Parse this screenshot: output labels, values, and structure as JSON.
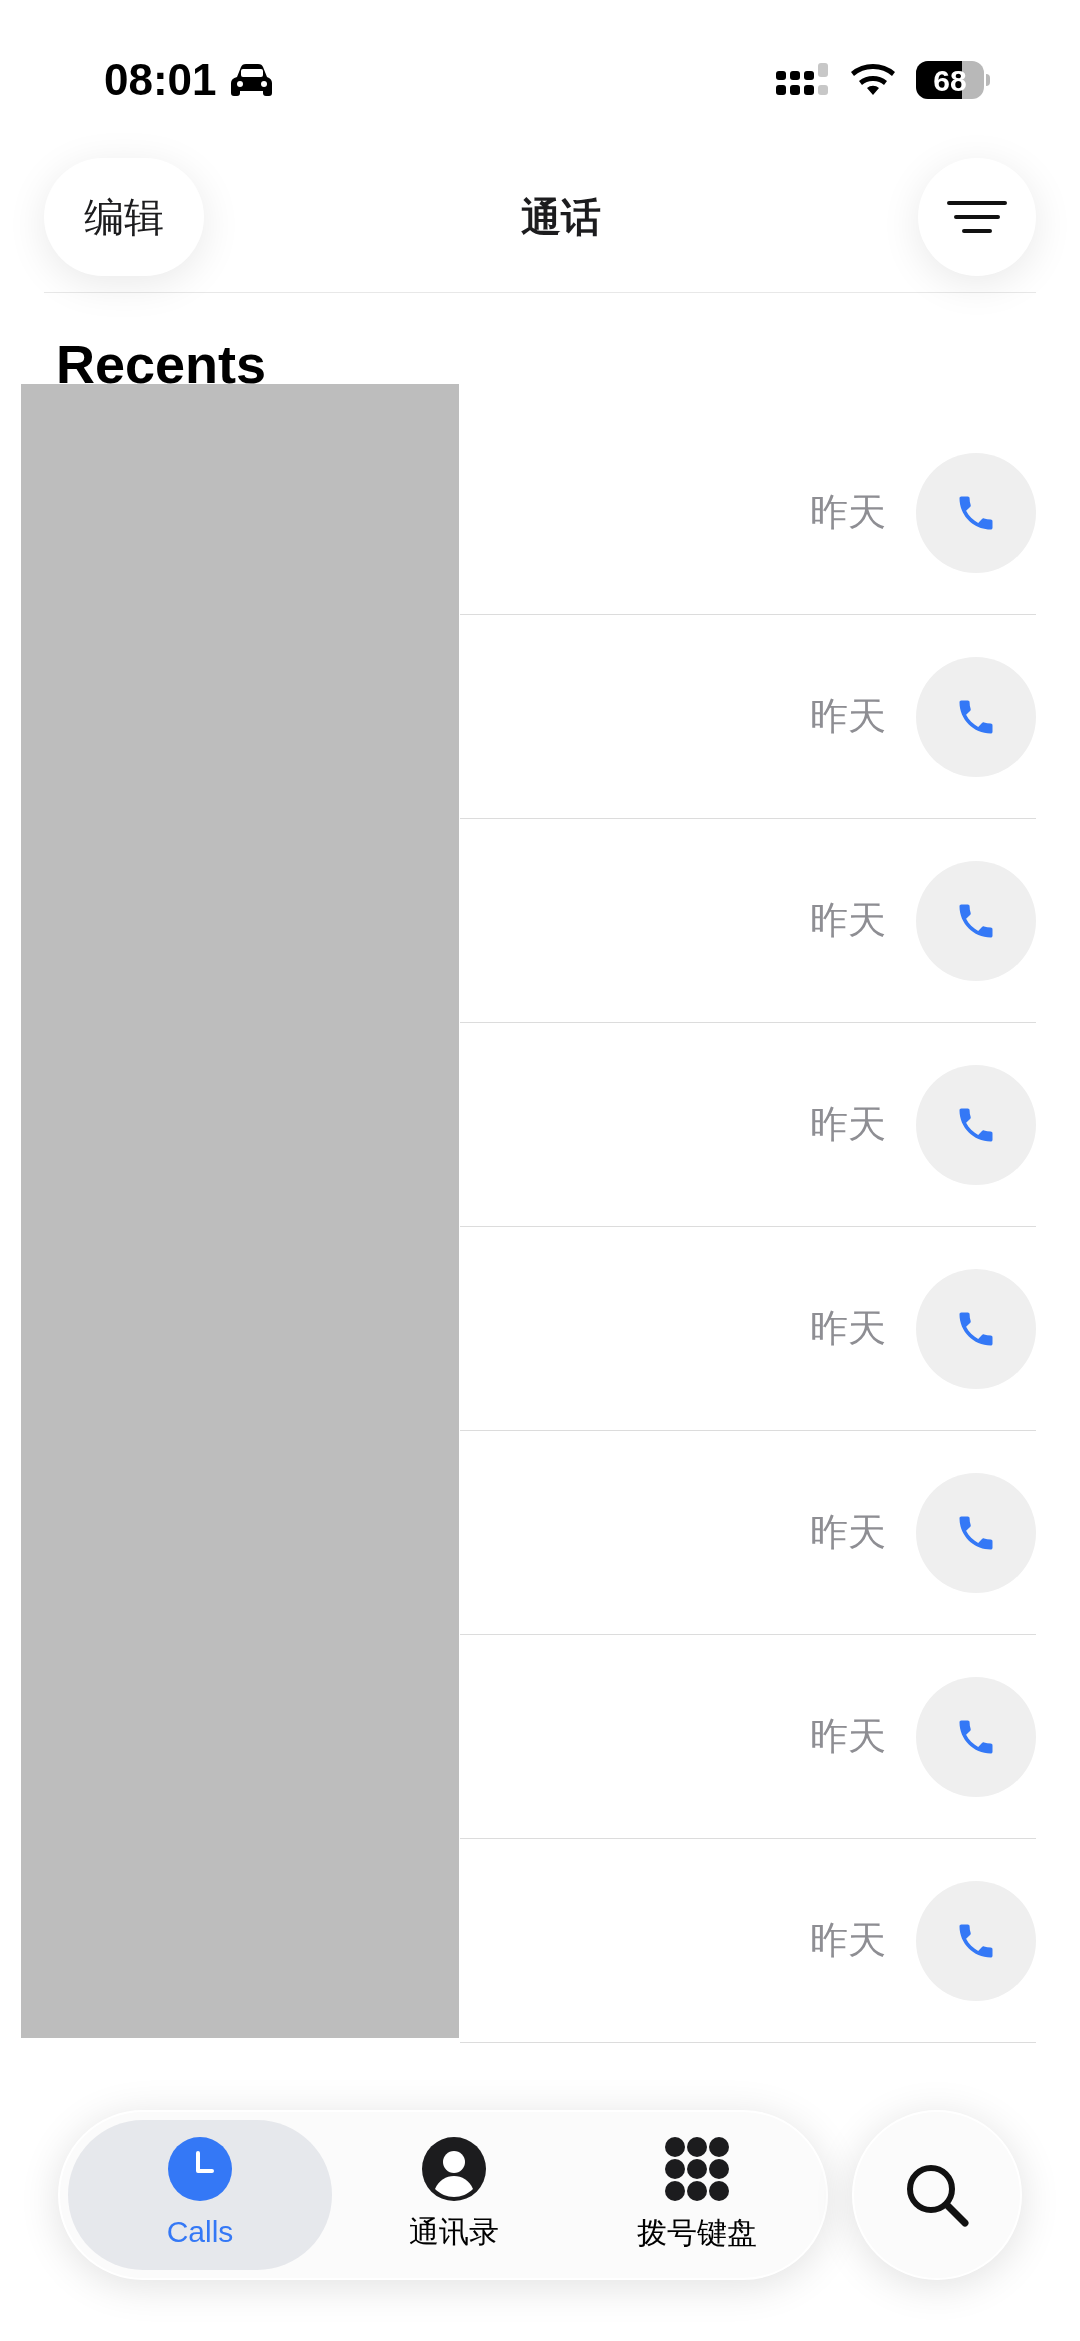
{
  "status_bar": {
    "time": "08:01",
    "battery": "68"
  },
  "header": {
    "edit_button": "编辑",
    "title": "通话"
  },
  "section_title": "Recents",
  "calls": [
    {
      "time": "昨天"
    },
    {
      "time": "昨天"
    },
    {
      "time": "昨天"
    },
    {
      "time": "昨天"
    },
    {
      "time": "昨天"
    },
    {
      "time": "昨天"
    },
    {
      "time": "昨天"
    },
    {
      "time": "昨天"
    }
  ],
  "tabs": [
    {
      "kind": "calls",
      "label": "Calls",
      "selected": true
    },
    {
      "kind": "contacts",
      "label": "通讯录",
      "selected": false
    },
    {
      "kind": "keypad",
      "label": "拨号键盘",
      "selected": false
    }
  ]
}
